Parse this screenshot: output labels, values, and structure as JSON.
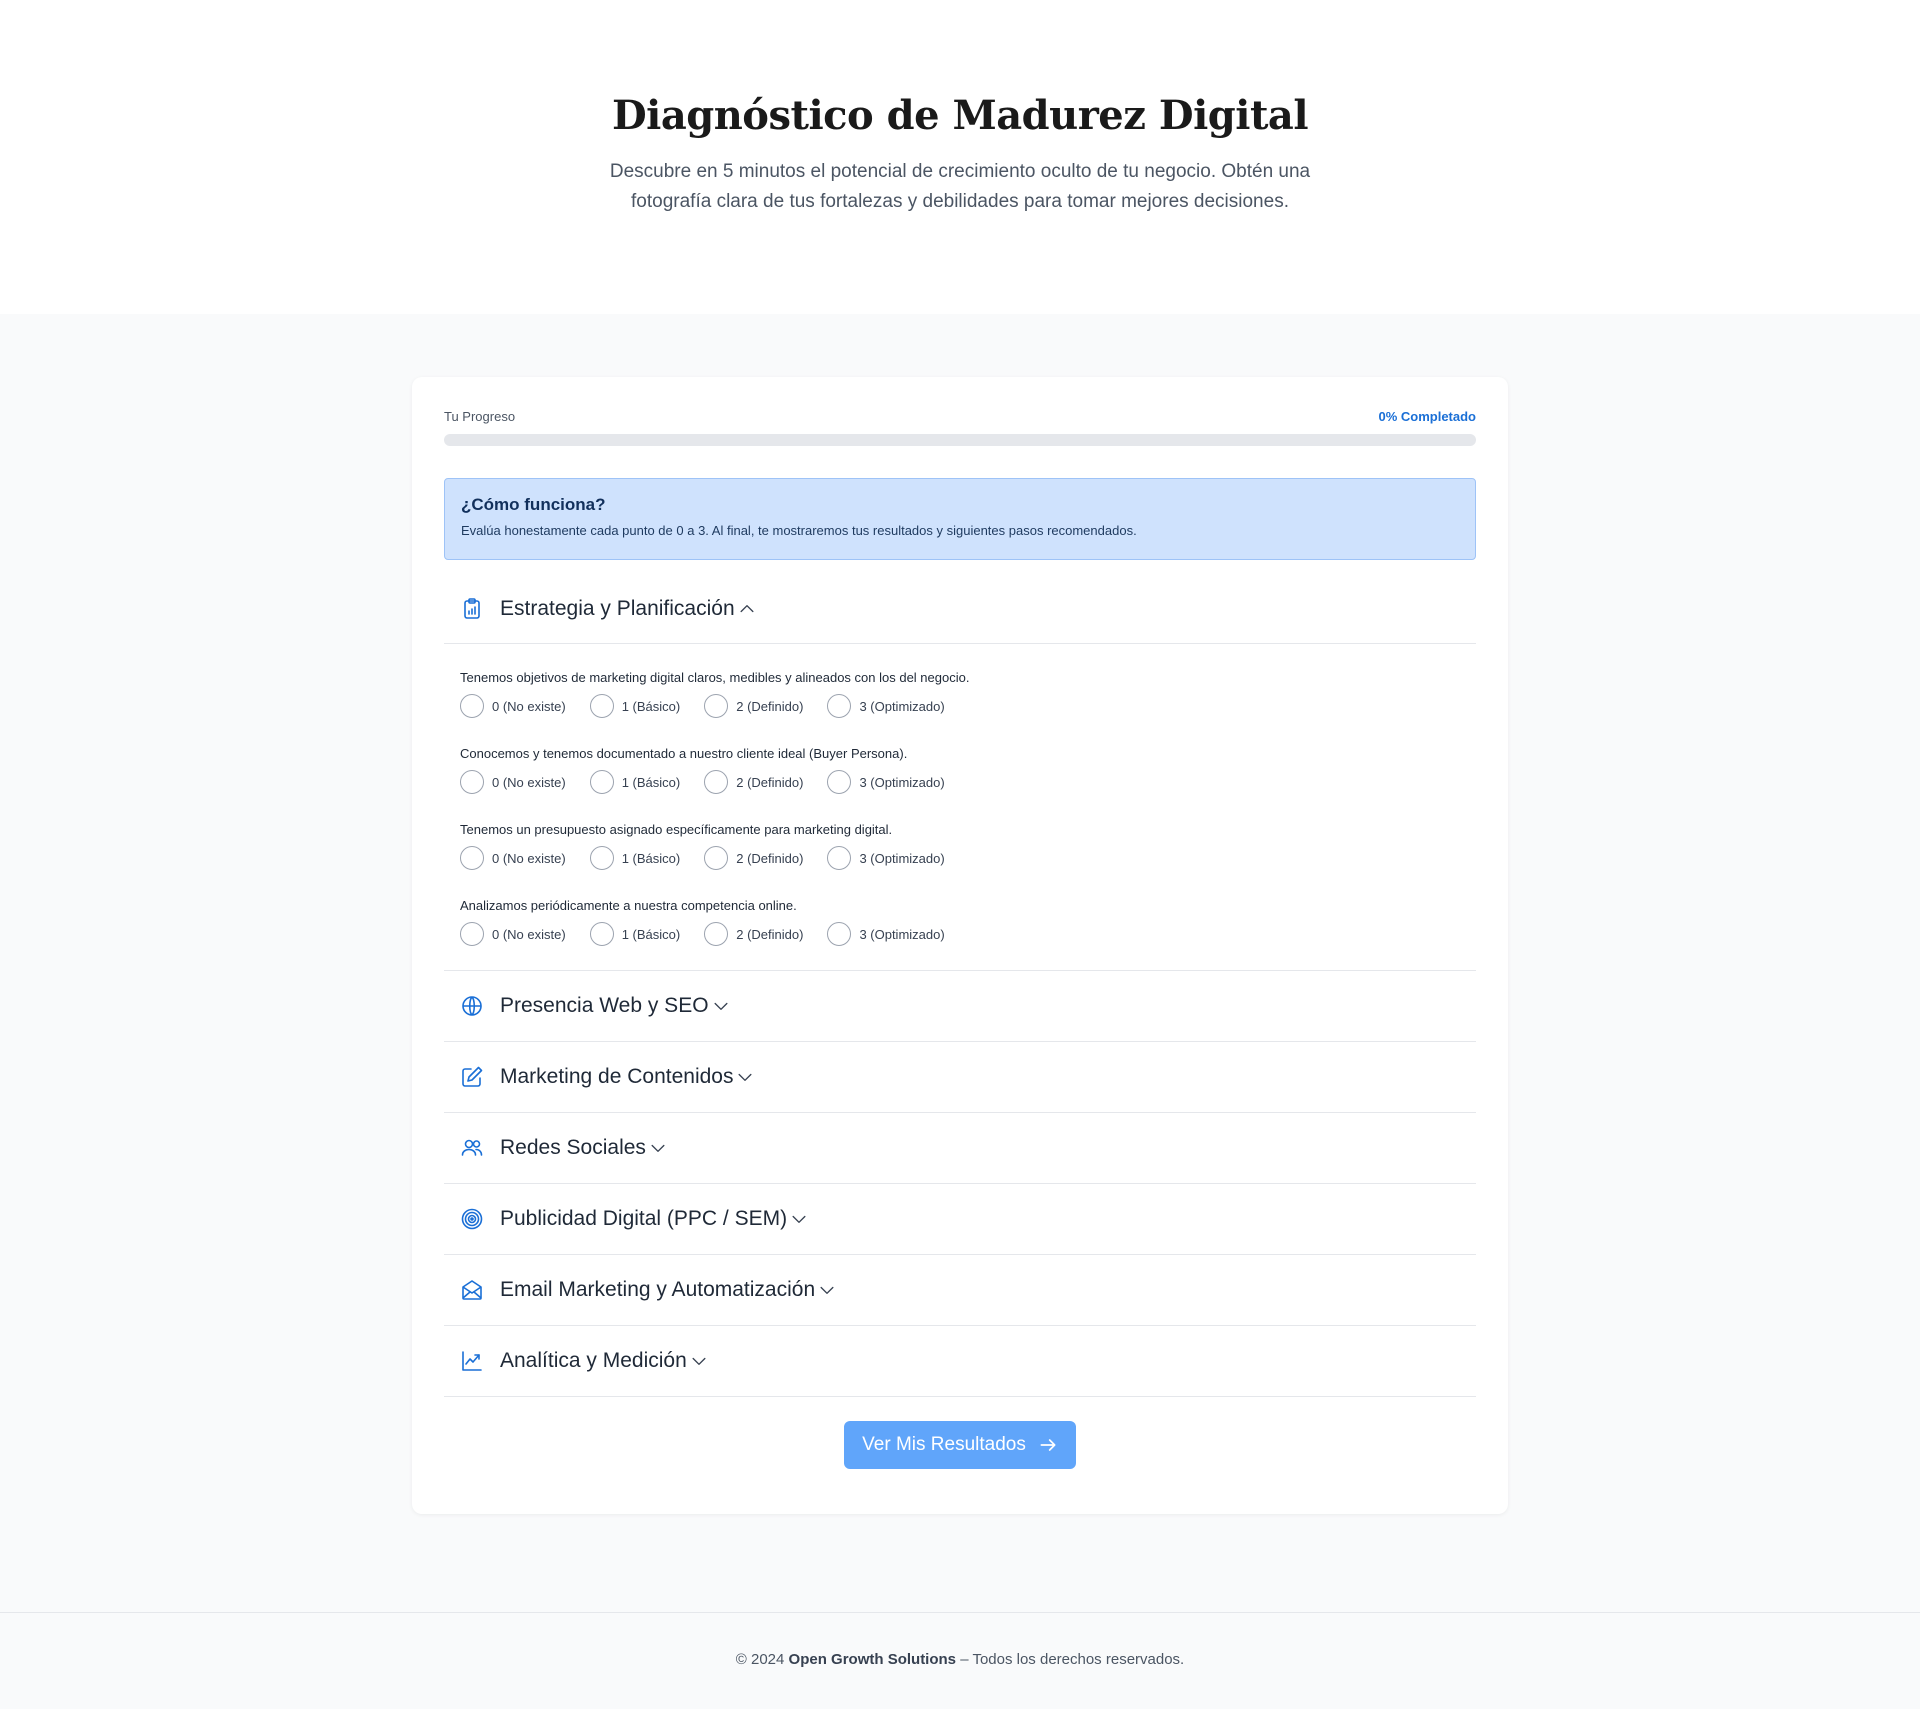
{
  "hero": {
    "title": "Diagnóstico de Madurez Digital",
    "subtitle": "Descubre en 5 minutos el potencial de crecimiento oculto de tu negocio. Obtén una fotografía clara de tus fortalezas y debilidades para tomar mejores decisiones."
  },
  "progress": {
    "label": "Tu Progreso",
    "value_text": "0% Completado",
    "percent": 0
  },
  "info": {
    "title": "¿Cómo funciona?",
    "text": "Evalúa honestamente cada punto de 0 a 3. Al final, te mostraremos tus resultados y siguientes pasos recomendados."
  },
  "options": [
    "0 (No existe)",
    "1 (Básico)",
    "2 (Definido)",
    "3 (Optimizado)"
  ],
  "sections": [
    {
      "title": "Estrategia y Planificación",
      "icon": "clipboard-chart-icon",
      "expanded": true,
      "questions": [
        "Tenemos objetivos de marketing digital claros, medibles y alineados con los del negocio.",
        "Conocemos y tenemos documentado a nuestro cliente ideal (Buyer Persona).",
        "Tenemos un presupuesto asignado específicamente para marketing digital.",
        "Analizamos periódicamente a nuestra competencia online."
      ]
    },
    {
      "title": "Presencia Web y SEO",
      "icon": "globe-icon",
      "expanded": false
    },
    {
      "title": "Marketing de Contenidos",
      "icon": "edit-icon",
      "expanded": false
    },
    {
      "title": "Redes Sociales",
      "icon": "users-icon",
      "expanded": false
    },
    {
      "title": "Publicidad Digital (PPC / SEM)",
      "icon": "target-icon",
      "expanded": false
    },
    {
      "title": "Email Marketing y Automatización",
      "icon": "envelope-icon",
      "expanded": false
    },
    {
      "title": "Analítica y Medición",
      "icon": "line-chart-icon",
      "expanded": false
    }
  ],
  "submit": {
    "label": "Ver Mis Resultados"
  },
  "footer": {
    "prefix": "© 2024",
    "brand": "Open Growth Solutions",
    "suffix": "– Todos los derechos reservados."
  },
  "colors": {
    "accent": "#1a6fd6",
    "button": "#60a5fa",
    "info_bg": "#cfe2fd"
  }
}
